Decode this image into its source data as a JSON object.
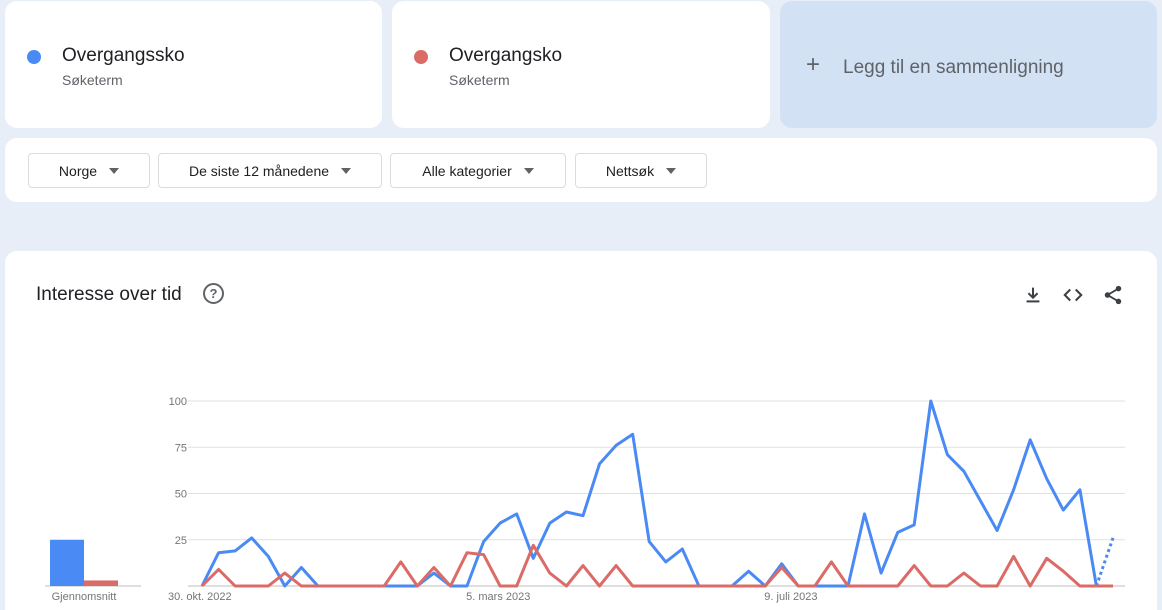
{
  "terms": [
    {
      "name": "Overgangssko",
      "type": "Søketerm",
      "color": "#4a8af4"
    },
    {
      "name": "Overgangsko",
      "type": "Søketerm",
      "color": "#db6b67"
    }
  ],
  "add_comparison": {
    "plus": "+",
    "label": "Legg til en sammenligning"
  },
  "filters": [
    {
      "label": "Norge"
    },
    {
      "label": "De siste 12 månedene"
    },
    {
      "label": "Alle kategorier"
    },
    {
      "label": "Nettsøk"
    }
  ],
  "chart": {
    "title": "Interesse over tid",
    "help_symbol": "?",
    "icons": [
      "download-icon",
      "embed-icon",
      "share-icon"
    ],
    "average_label": "Gjennomsnitt"
  },
  "chart_data": {
    "type": "line",
    "ylim": [
      0,
      100
    ],
    "yticks": [
      25,
      50,
      75,
      100
    ],
    "grid": true,
    "x_labels": [
      {
        "index": 0,
        "label": "30. okt. 2022"
      },
      {
        "index": 18,
        "label": "5. mars 2023"
      },
      {
        "index": 36,
        "label": "9. juli 2023"
      }
    ],
    "series": [
      {
        "name": "Overgangssko",
        "color": "#4a8af4",
        "average": 25,
        "partial_last": true,
        "values": [
          0,
          18,
          19,
          26,
          16,
          0,
          10,
          0,
          0,
          0,
          0,
          0,
          0,
          0,
          7,
          0,
          0,
          24,
          34,
          39,
          15,
          34,
          40,
          38,
          66,
          76,
          82,
          24,
          13,
          20,
          0,
          0,
          0,
          8,
          0,
          12,
          0,
          0,
          0,
          0,
          39,
          7,
          29,
          33,
          100,
          71,
          62,
          46,
          30,
          52,
          79,
          58,
          41,
          52,
          0,
          26
        ]
      },
      {
        "name": "Overgangsko",
        "color": "#db6b67",
        "average": 3,
        "partial_last": false,
        "values": [
          0,
          9,
          0,
          0,
          0,
          7,
          0,
          0,
          0,
          0,
          0,
          0,
          13,
          0,
          10,
          0,
          18,
          17,
          0,
          0,
          22,
          7,
          0,
          11,
          0,
          11,
          0,
          0,
          0,
          0,
          0,
          0,
          0,
          0,
          0,
          10,
          0,
          0,
          13,
          0,
          0,
          0,
          0,
          11,
          0,
          0,
          7,
          0,
          0,
          16,
          0,
          15,
          8,
          0,
          0,
          0
        ]
      }
    ]
  }
}
